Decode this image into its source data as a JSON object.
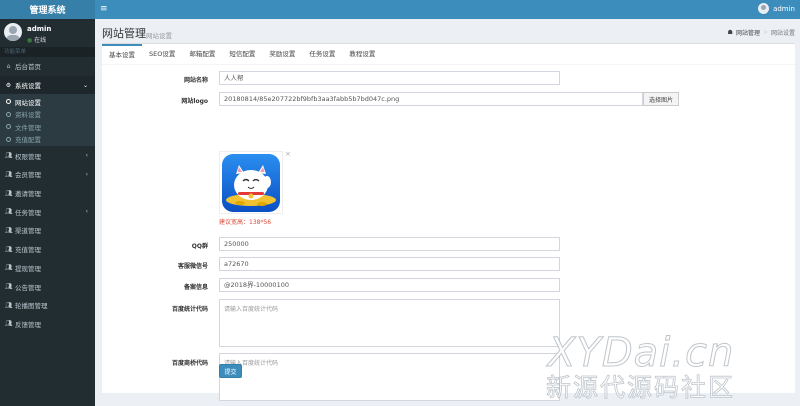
{
  "app": {
    "title": "管理系统",
    "top_user": "admin"
  },
  "sidebar": {
    "user": {
      "name": "admin",
      "status": "在线"
    },
    "header": "功能菜单",
    "items": [
      {
        "label": "后台首页",
        "icon": "home-icon"
      },
      {
        "label": "系统设置",
        "icon": "gear-icon",
        "open": true,
        "children": [
          {
            "label": "网站设置",
            "active": true
          },
          {
            "label": "资料设置"
          },
          {
            "label": "文件管理"
          },
          {
            "label": "充值配置"
          }
        ]
      },
      {
        "label": "权限管理",
        "icon": "users-icon",
        "chevron": true
      },
      {
        "label": "会员管理",
        "icon": "users-icon",
        "chevron": true
      },
      {
        "label": "邀请管理",
        "icon": "users-icon"
      },
      {
        "label": "任务管理",
        "icon": "users-icon",
        "chevron": true
      },
      {
        "label": "渠道管理",
        "icon": "users-icon"
      },
      {
        "label": "充值管理",
        "icon": "users-icon"
      },
      {
        "label": "提现管理",
        "icon": "users-icon"
      },
      {
        "label": "公告管理",
        "icon": "users-icon"
      },
      {
        "label": "轮播图管理",
        "icon": "users-icon"
      },
      {
        "label": "反馈管理",
        "icon": "users-icon"
      }
    ]
  },
  "header": {
    "title": "网站管理",
    "subtitle": "网站设置",
    "breadcrumb": [
      "网站管理",
      "网站设置"
    ]
  },
  "tabs": [
    "基本设置",
    "SEO设置",
    "邮箱配置",
    "短信配置",
    "奖励设置",
    "任务设置",
    "教程设置"
  ],
  "form": {
    "site_name": {
      "label": "网站名称",
      "value": "人人帮"
    },
    "site_logo": {
      "label": "网站logo",
      "value": "20180814/85e207722bf9bfb3aa3fabb5b7bd047c.png",
      "choose_label": "选择图片",
      "hint": "建议宽高：138*56"
    },
    "qq_group": {
      "label": "QQ群",
      "value": "250000"
    },
    "wechat": {
      "label": "客服微信号",
      "value": "a72670"
    },
    "icp": {
      "label": "备案信息",
      "value": "@2018界-10000100"
    },
    "baidu_stats": {
      "label": "百度统计代码",
      "placeholder": "请输入百度统计代码"
    },
    "baidu_bridge": {
      "label": "百度商桥代码",
      "placeholder": "请输入百度统计代码"
    },
    "submit_label": "提交"
  },
  "watermark": {
    "line1": "XYDai.cn",
    "line2": "新源代源码社区"
  },
  "colors": {
    "primary": "#3c8dbc",
    "sidebar_bg": "#222d32",
    "danger": "#dd4b39"
  }
}
